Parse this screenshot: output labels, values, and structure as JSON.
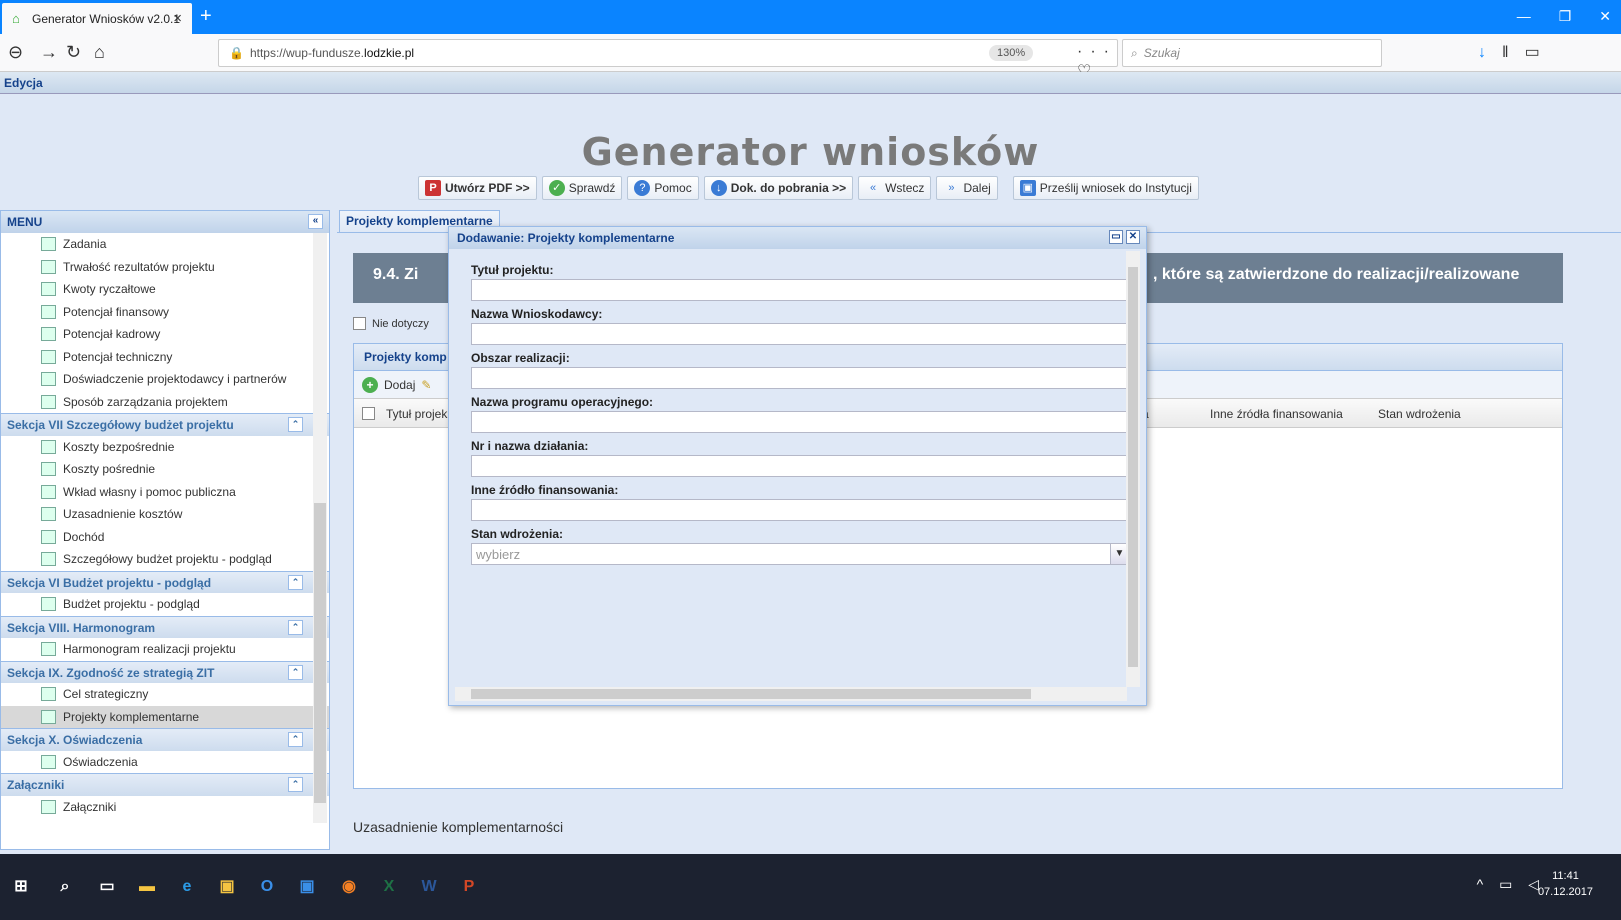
{
  "browser": {
    "tab_title": "Generator Wniosków v2.0.1",
    "url_prefix": "https://wup-fundusze.",
    "url_domain": "lodzkie.pl",
    "zoom": "130%",
    "search_placeholder": "Szukaj"
  },
  "app": {
    "edit_label": "Edycja",
    "title": "Generator wniosków",
    "toolbar": {
      "pdf": "Utwórz PDF >>",
      "check": "Sprawdź",
      "help": "Pomoc",
      "docs": "Dok. do pobrania >>",
      "back": "Wstecz",
      "next": "Dalej",
      "send": "Prześlij wniosek do Instytucji"
    }
  },
  "sidebar": {
    "title": "MENU",
    "items": [
      {
        "type": "item",
        "label": "Zadania"
      },
      {
        "type": "item",
        "label": "Trwałość rezultatów projektu"
      },
      {
        "type": "item",
        "label": "Kwoty ryczałtowe"
      },
      {
        "type": "item",
        "label": "Potencjał finansowy"
      },
      {
        "type": "item",
        "label": "Potencjał kadrowy"
      },
      {
        "type": "item",
        "label": "Potencjał techniczny"
      },
      {
        "type": "item",
        "label": "Doświadczenie projektodawcy i partnerów"
      },
      {
        "type": "item",
        "label": "Sposób zarządzania projektem"
      },
      {
        "type": "head",
        "label": "Sekcja VII Szczegółowy budżet projektu"
      },
      {
        "type": "item",
        "label": "Koszty bezpośrednie"
      },
      {
        "type": "item",
        "label": "Koszty pośrednie"
      },
      {
        "type": "item",
        "label": "Wkład własny i pomoc publiczna"
      },
      {
        "type": "item",
        "label": "Uzasadnienie kosztów"
      },
      {
        "type": "item",
        "label": "Dochód"
      },
      {
        "type": "item",
        "label": "Szczegółowy budżet projektu - podgląd"
      },
      {
        "type": "head",
        "label": "Sekcja VI Budżet projektu - podgląd"
      },
      {
        "type": "item",
        "label": "Budżet projektu - podgląd"
      },
      {
        "type": "head",
        "label": "Sekcja VIII. Harmonogram"
      },
      {
        "type": "item",
        "label": "Harmonogram realizacji projektu"
      },
      {
        "type": "head",
        "label": "Sekcja IX. Zgodność ze strategią ZIT"
      },
      {
        "type": "item",
        "label": "Cel strategiczny"
      },
      {
        "type": "item",
        "label": "Projekty komplementarne",
        "selected": true
      },
      {
        "type": "head",
        "label": "Sekcja X. Oświadczenia"
      },
      {
        "type": "item",
        "label": "Oświadczenia"
      },
      {
        "type": "head",
        "label": "Załączniki"
      },
      {
        "type": "item",
        "label": "Załączniki"
      }
    ]
  },
  "main": {
    "tab": "Projekty komplementarne",
    "section_left": "9.4. Zi",
    "section_right": ", które są zatwierdzone do realizacji/realizowane",
    "not_applicable": "Nie dotyczy",
    "grid_tab": "Projekty komp",
    "add": "Dodaj",
    "col_title": "Tytuł projek",
    "col_a": "a",
    "col_other": "Inne źródła finansowania",
    "col_state": "Stan wdrożenia",
    "justification": "Uzasadnienie komplementarności"
  },
  "dialog": {
    "title": "Dodawanie: Projekty komplementarne",
    "fields": {
      "title": "Tytuł projektu:",
      "applicant": "Nazwa Wnioskodawcy:",
      "area": "Obszar realizacji:",
      "program": "Nazwa programu operacyjnego:",
      "action": "Nr i nazwa działania:",
      "funding": "Inne źródło finansowania:",
      "state": "Stan wdrożenia:",
      "state_placeholder": "wybierz"
    }
  },
  "taskbar": {
    "time": "11:41",
    "date": "07.12.2017"
  }
}
